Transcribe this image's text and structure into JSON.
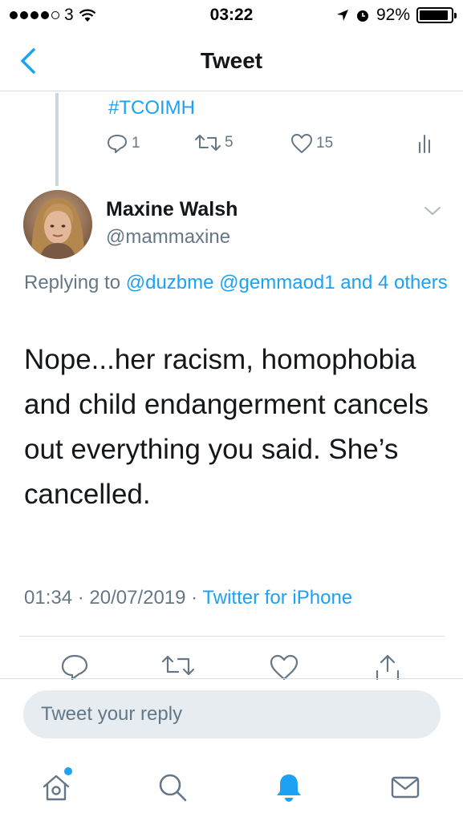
{
  "status_bar": {
    "carrier": "3",
    "time": "03:22",
    "battery_percent": "92%",
    "battery_level": 0.92,
    "signal_dots_filled": 4,
    "signal_dots_total": 5
  },
  "nav": {
    "title": "Tweet",
    "back_icon": "chevron-left-icon"
  },
  "parent_tweet": {
    "hashtag": "#TCOIMH",
    "reply_count": "1",
    "retweet_count": "5",
    "like_count": "15"
  },
  "tweet": {
    "author_name": "Maxine Walsh",
    "author_handle": "@mammaxine",
    "replying_label": "Replying to",
    "mention_1": "@duzbme",
    "mention_2": "@gemmaod1",
    "mention_others": "and 4 others",
    "text": "Nope...her racism, homophobia and child endangerment cancels out everything you said. She’s cancelled.",
    "timestamp": "01:34 · 20/07/2019 · ",
    "source": "Twitter for iPhone"
  },
  "reply_box": {
    "placeholder": "Tweet your reply"
  },
  "tab_bar": {
    "items": [
      "home-icon",
      "search-icon",
      "notifications-icon",
      "messages-icon"
    ],
    "active": "notifications-icon"
  },
  "colors": {
    "accent": "#1da1f2",
    "text": "#14171a",
    "secondary": "#657786",
    "border": "#d8dde1",
    "input_bg": "#e6ecf0"
  }
}
